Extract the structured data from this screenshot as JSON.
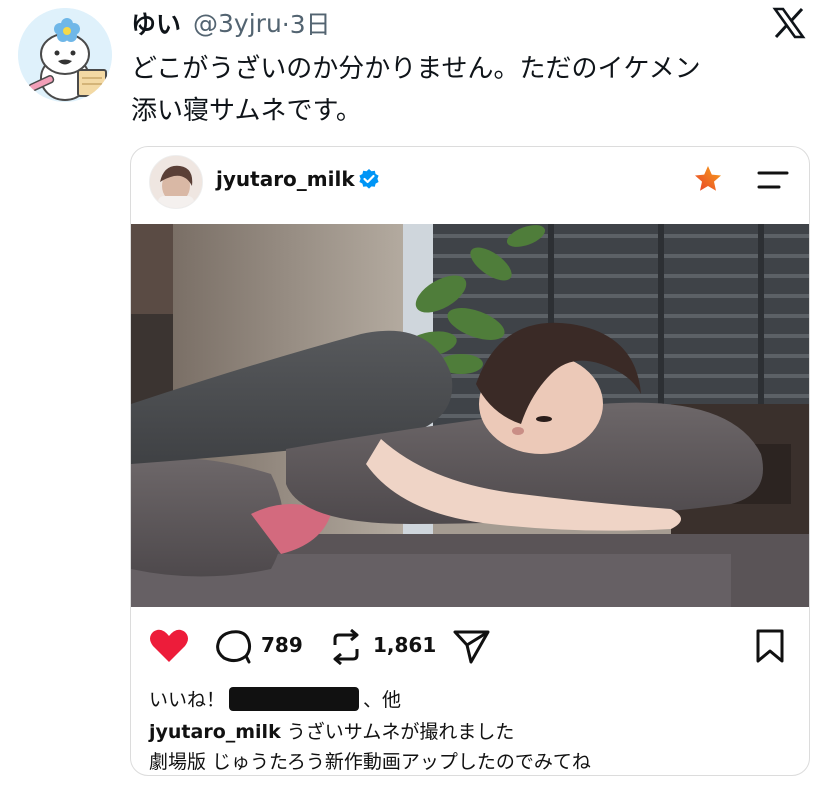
{
  "tweet": {
    "display_name": "ゆい",
    "handle": "@3yjru",
    "time": "·3日",
    "text_line1": "どこがうざいのか分かりません。ただのイケメン",
    "text_line2": "添い寝サムネです。",
    "logo": "x-logo-icon"
  },
  "embed": {
    "username": "jyutaro_milk",
    "verified": true,
    "actions": {
      "comments": "789",
      "reposts": "1,861"
    },
    "likes": {
      "prefix": "いいね！",
      "suffix": "、他"
    },
    "caption": {
      "user": "jyutaro_milk",
      "text": " うざいサムネが撮れました",
      "line2": "劇場版 じゅうたろう新作動画アップしたのでみてね"
    },
    "colors": {
      "like": "#ed1c3a",
      "verified": "#0095f6",
      "star_outer": "#e8402a",
      "star_inner": "#f7a21b"
    }
  }
}
